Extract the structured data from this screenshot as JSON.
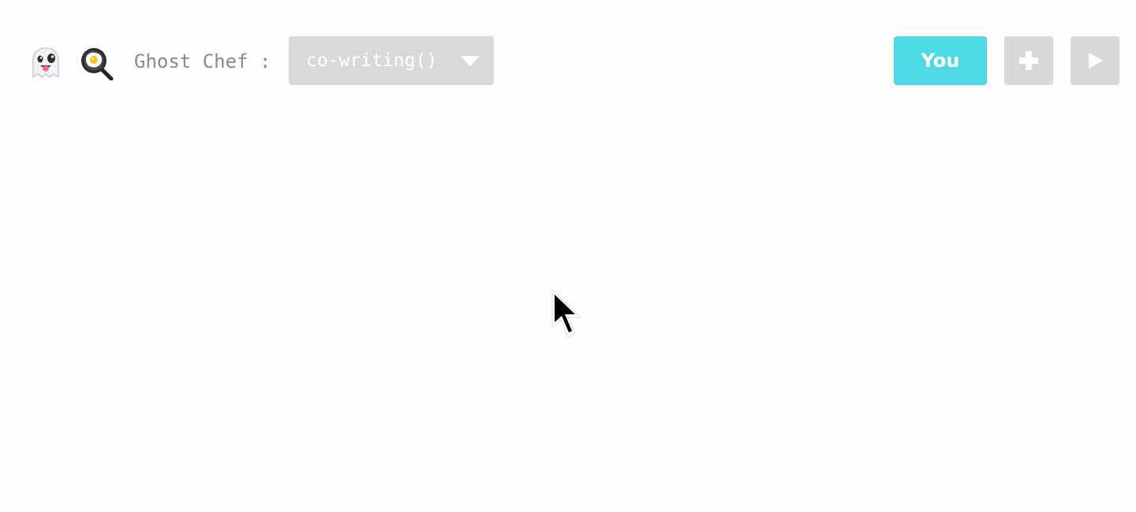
{
  "header": {
    "icons": [
      "ghost-icon",
      "frying-pan-icon"
    ],
    "app_label": "Ghost Chef :",
    "mode_select": {
      "value": "co-writing()"
    },
    "actions": {
      "you_label": "You",
      "add_icon": "plus-icon",
      "play_icon": "play-icon"
    }
  },
  "colors": {
    "background": "#fdfdfd",
    "accent": "#4fd9e6",
    "control_gray": "#d8d8d8",
    "label_gray": "#8a8a8a"
  },
  "cursor": {
    "icon": "mouse-pointer-icon"
  }
}
